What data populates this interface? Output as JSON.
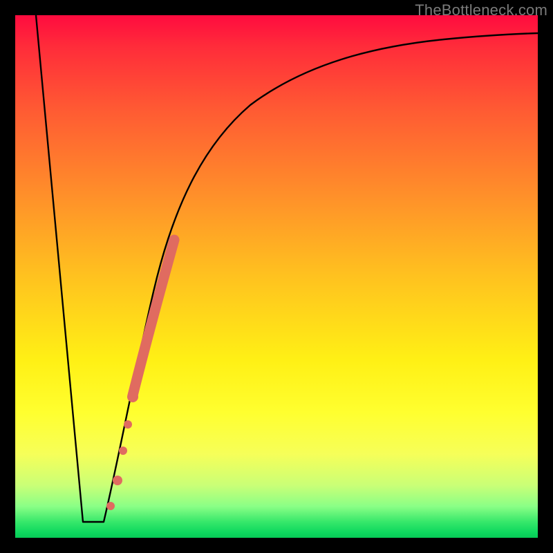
{
  "watermark": "TheBottleneck.com",
  "chart_data": {
    "type": "line",
    "title": "",
    "xlabel": "",
    "ylabel": "",
    "xlim": [
      0,
      100
    ],
    "ylim": [
      0,
      100
    ],
    "grid": false,
    "legend": false,
    "series": [
      {
        "name": "left-descent",
        "x": [
          4,
          13
        ],
        "y": [
          100,
          3
        ],
        "stroke": "#000000"
      },
      {
        "name": "floor",
        "x": [
          13,
          17
        ],
        "y": [
          3,
          3
        ],
        "stroke": "#000000"
      },
      {
        "name": "recovery-curve",
        "x": [
          17,
          20,
          23,
          26,
          29,
          32,
          35,
          40,
          46,
          54,
          64,
          76,
          88,
          100
        ],
        "y": [
          3,
          17,
          31,
          43,
          53,
          61,
          67,
          74,
          80,
          85,
          89,
          92,
          94,
          95
        ],
        "stroke": "#000000"
      },
      {
        "name": "highlight-segment",
        "x": [
          22.5,
          30.5
        ],
        "y": [
          27,
          57
        ],
        "stroke": "#e06b60",
        "thick": true
      }
    ],
    "dots": [
      {
        "x": 18.3,
        "y": 6,
        "r": 6,
        "fill": "#e06b60"
      },
      {
        "x": 19.6,
        "y": 11,
        "r": 7,
        "fill": "#e06b60"
      },
      {
        "x": 20.7,
        "y": 17,
        "r": 6,
        "fill": "#e06b60"
      },
      {
        "x": 21.6,
        "y": 22,
        "r": 6,
        "fill": "#e06b60"
      },
      {
        "x": 22.5,
        "y": 27,
        "r": 8,
        "fill": "#e06b60"
      }
    ],
    "gradient_stops": [
      {
        "pos": 0,
        "color": "#ff0b3f"
      },
      {
        "pos": 50,
        "color": "#ffc21f"
      },
      {
        "pos": 76,
        "color": "#ffff2f"
      },
      {
        "pos": 100,
        "color": "#07c957"
      }
    ]
  }
}
